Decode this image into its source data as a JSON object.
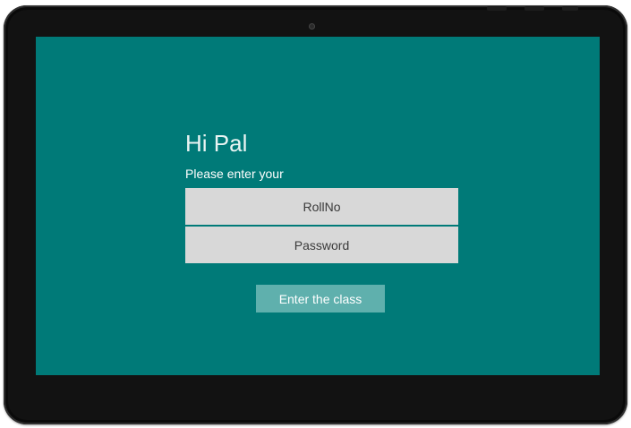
{
  "login": {
    "greeting": "Hi Pal",
    "instruction": "Please enter your",
    "rollno_placeholder": "RollNo",
    "rollno_value": "",
    "password_placeholder": "Password",
    "password_value": "",
    "enter_button_label": "Enter the class"
  },
  "colors": {
    "screen_background": "#007a78",
    "field_background": "#d8d8d8",
    "button_background": "#5fb0ad",
    "device_bezel": "#121212"
  }
}
